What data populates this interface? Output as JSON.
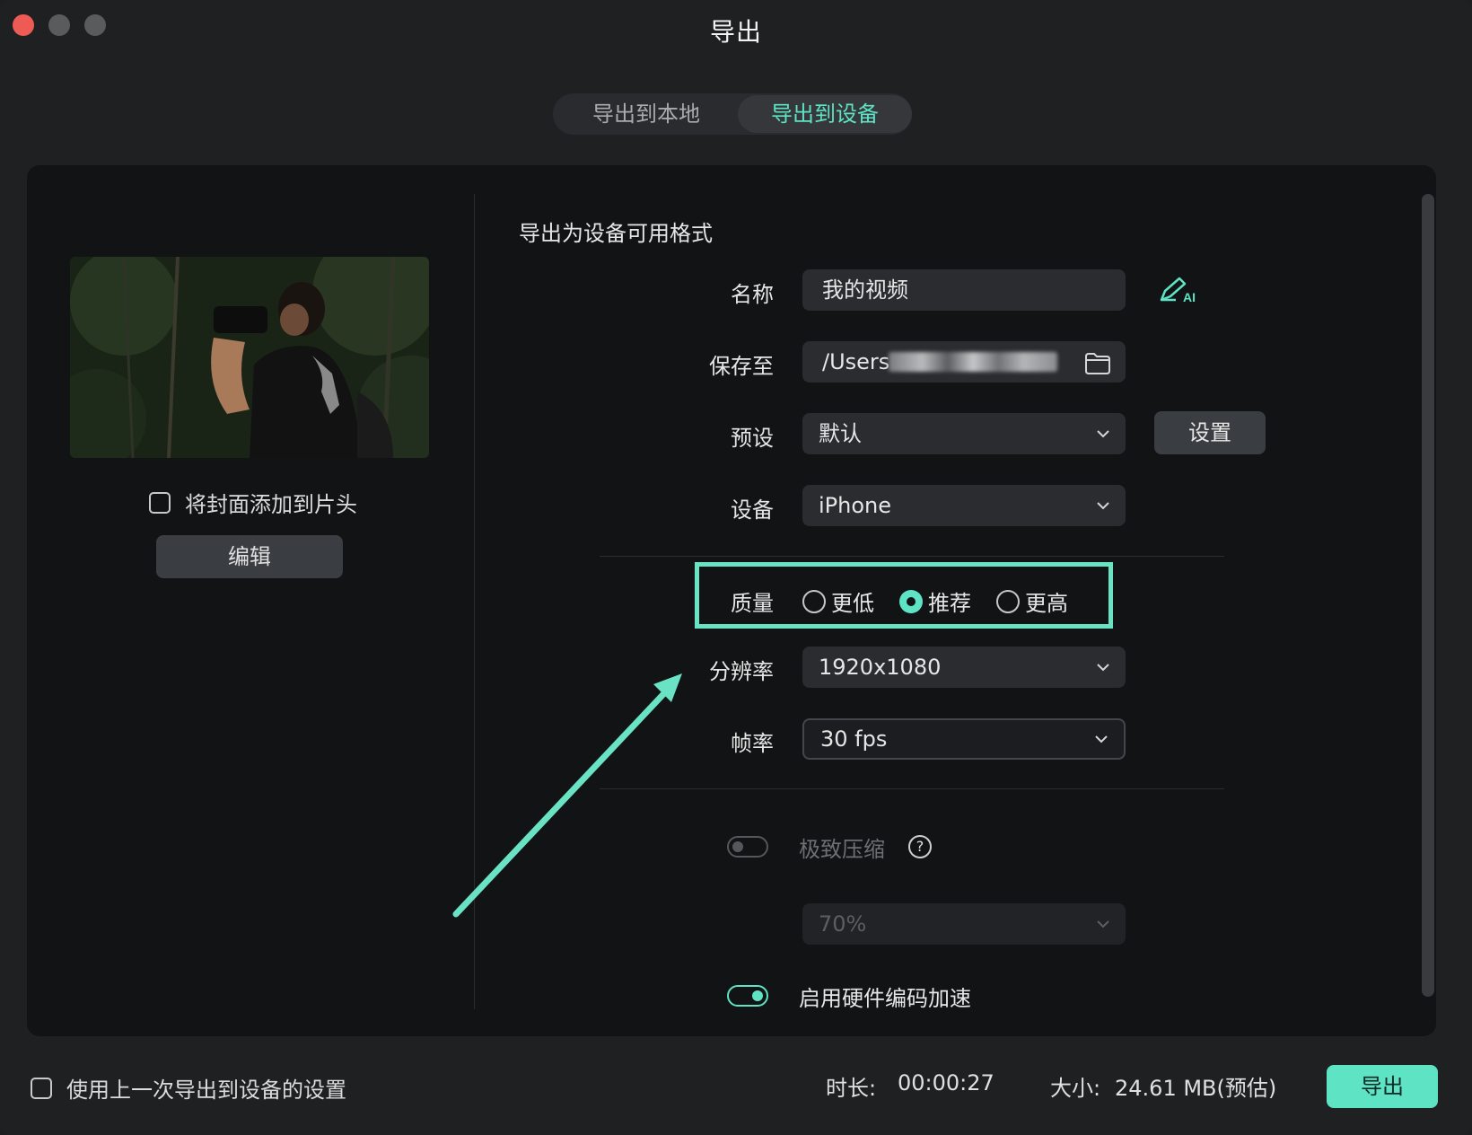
{
  "window": {
    "title": "导出"
  },
  "tabs": [
    {
      "label": "导出到本地",
      "active": false
    },
    {
      "label": "导出到设备",
      "active": true
    }
  ],
  "left": {
    "cover_checkbox_label": "将封面添加到片头",
    "cover_checked": false,
    "edit_button": "编辑"
  },
  "form": {
    "section_title": "导出为设备可用格式",
    "name": {
      "label": "名称",
      "value": "我的视频",
      "ai_icon": "ai-pen-icon"
    },
    "save_to": {
      "label": "保存至",
      "value": "/Users",
      "icon": "folder-icon"
    },
    "preset": {
      "label": "预设",
      "value": "默认",
      "settings_button": "设置"
    },
    "device": {
      "label": "设备",
      "value": "iPhone"
    },
    "quality": {
      "label": "质量",
      "options": [
        "更低",
        "推荐",
        "更高"
      ],
      "selected": "推荐"
    },
    "resolution": {
      "label": "分辨率",
      "value": "1920x1080"
    },
    "framerate": {
      "label": "帧率",
      "value": "30 fps"
    },
    "compression": {
      "label": "极致压缩",
      "enabled": false,
      "help_icon": "?",
      "percent": "70%"
    },
    "hw_accel": {
      "label": "启用硬件编码加速",
      "enabled": true
    }
  },
  "footer": {
    "use_last_label": "使用上一次导出到设备的设置",
    "duration_label": "时长:",
    "duration_value": "00:00:27",
    "size_label": "大小:",
    "size_value": "24.61 MB(预估)",
    "export_button": "导出"
  },
  "colors": {
    "accent": "#5fe3c5",
    "background": "#1f2022",
    "panel": "#121314"
  }
}
